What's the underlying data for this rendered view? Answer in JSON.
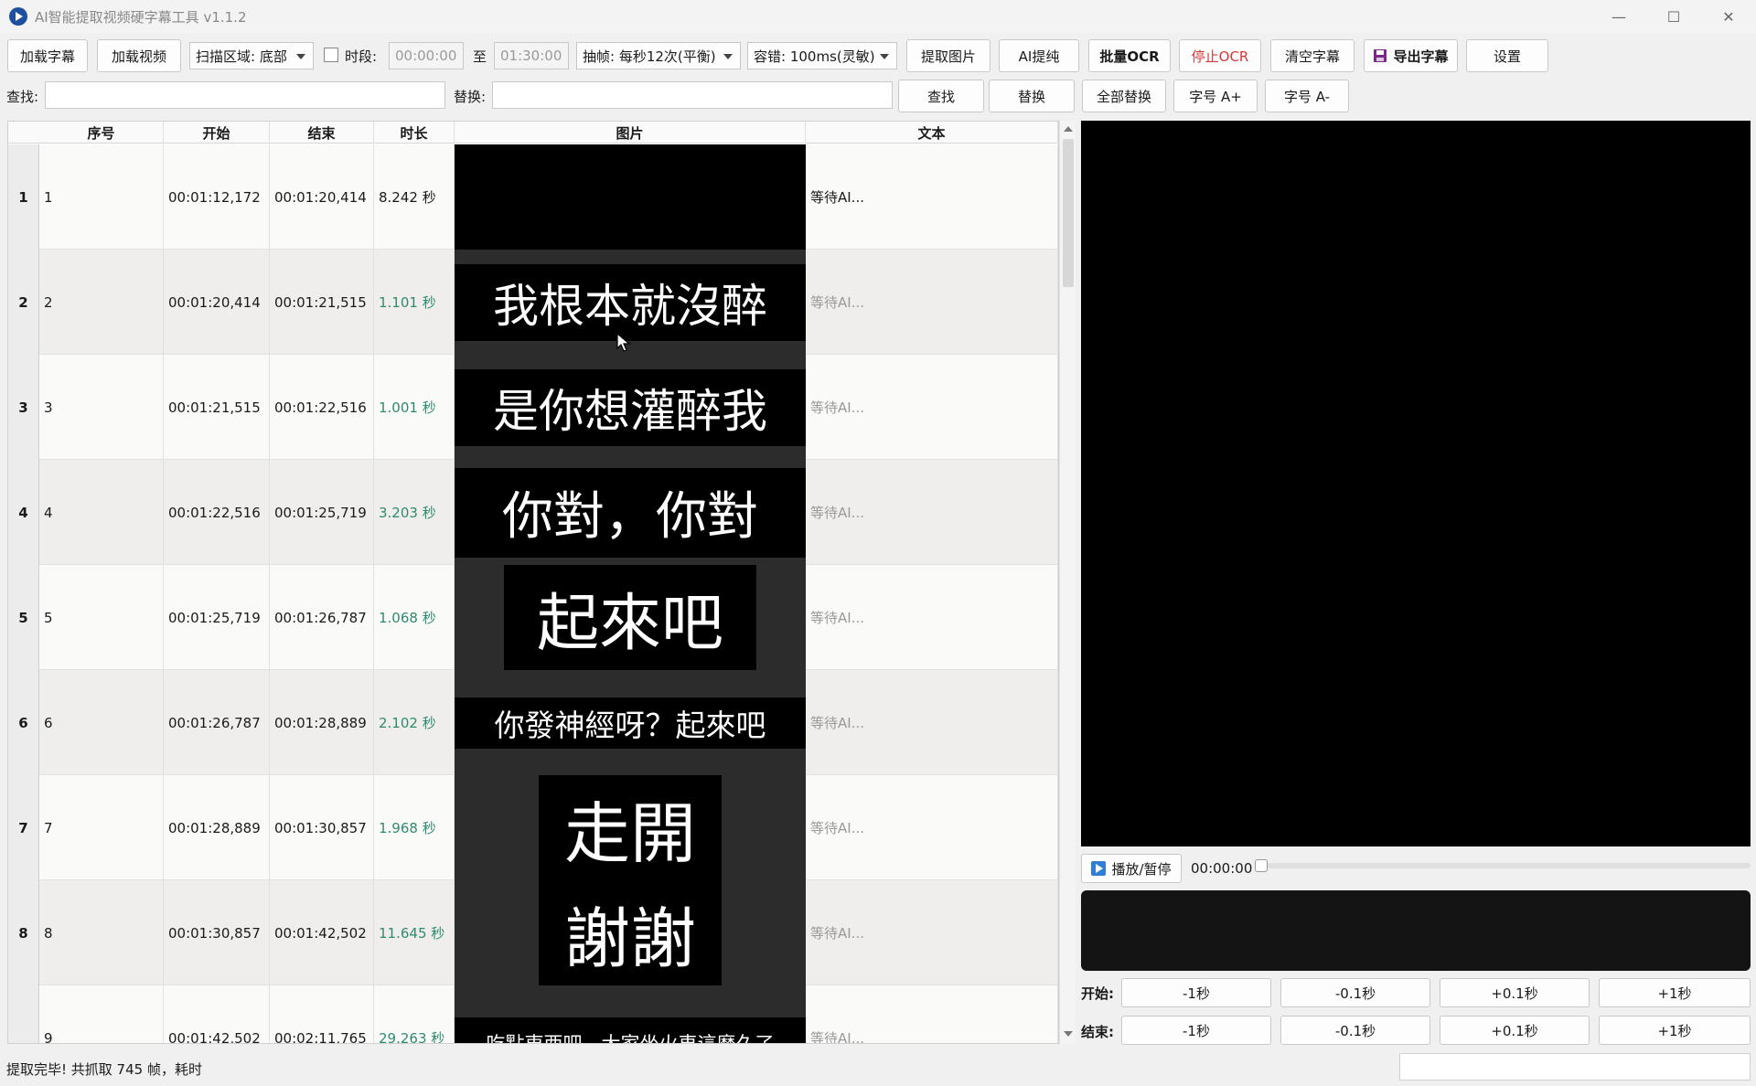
{
  "window": {
    "title": "AI智能提取视频硬字幕工具 v1.1.2",
    "minimize": "—",
    "maximize": "☐",
    "close": "✕"
  },
  "toolbar": {
    "load_subtitle": "加载字幕",
    "load_video": "加载视频",
    "scan_area": "扫描区域: 底部",
    "segment_label": "时段:",
    "segment_start": "00:00:00",
    "to_label": "至",
    "segment_end": "01:30:00",
    "frame_rate": "抽帧: 每秒12次(平衡)",
    "tolerance": "容错: 100ms(灵敏)",
    "extract_images": "提取图片",
    "ai_refine": "AI提纯",
    "batch_ocr": "批量OCR",
    "stop_ocr": "停止OCR",
    "clear_subtitles": "清空字幕",
    "export_subtitles": "导出字幕",
    "settings": "设置"
  },
  "search": {
    "find_label": "查找:",
    "replace_label": "替换:",
    "find_value": "",
    "replace_value": "",
    "find_button": "查找",
    "replace_button": "替换",
    "replace_all_button": "全部替换",
    "font_increase": "字号 A+",
    "font_decrease": "字号 A-"
  },
  "table": {
    "columns": [
      "序号",
      "开始",
      "结束",
      "时长",
      "图片",
      "文本"
    ],
    "rows": [
      {
        "row": "1",
        "index": "1",
        "start": "00:01:12,172",
        "end": "00:01:20,414",
        "duration": "8.242 秒",
        "image_text": "",
        "text": "等待AI..."
      },
      {
        "row": "2",
        "index": "2",
        "start": "00:01:20,414",
        "end": "00:01:21,515",
        "duration": "1.101 秒",
        "image_text": "我根本就沒醉",
        "text": "等待AI..."
      },
      {
        "row": "3",
        "index": "3",
        "start": "00:01:21,515",
        "end": "00:01:22,516",
        "duration": "1.001 秒",
        "image_text": "是你想灌醉我",
        "text": "等待AI..."
      },
      {
        "row": "4",
        "index": "4",
        "start": "00:01:22,516",
        "end": "00:01:25,719",
        "duration": "3.203 秒",
        "image_text": "你對，你對",
        "text": "等待AI..."
      },
      {
        "row": "5",
        "index": "5",
        "start": "00:01:25,719",
        "end": "00:01:26,787",
        "duration": "1.068 秒",
        "image_text": "起來吧",
        "text": "等待AI..."
      },
      {
        "row": "6",
        "index": "6",
        "start": "00:01:26,787",
        "end": "00:01:28,889",
        "duration": "2.102 秒",
        "image_text": "你發神經呀？起來吧",
        "text": "等待AI..."
      },
      {
        "row": "7",
        "index": "7",
        "start": "00:01:28,889",
        "end": "00:01:30,857",
        "duration": "1.968 秒",
        "image_text": "走開",
        "text": "等待AI..."
      },
      {
        "row": "8",
        "index": "8",
        "start": "00:01:30,857",
        "end": "00:01:42,502",
        "duration": "11.645 秒",
        "image_text": "謝謝",
        "text": "等待AI..."
      },
      {
        "row": "9",
        "index": "9",
        "start": "00:01:42,502",
        "end": "00:02:11,765",
        "duration": "29.263 秒",
        "image_text": "吃點東西吧，大家坐火車這麼久了",
        "text": "等待AI..."
      }
    ]
  },
  "player": {
    "play_pause": "播放/暂停",
    "time": "00:00:00",
    "progress": 0
  },
  "adjust": {
    "start_label": "开始:",
    "end_label": "结束:",
    "minus_1s": "-1秒",
    "minus_01s": "-0.1秒",
    "plus_01s": "+0.1秒",
    "plus_1s": "+1秒"
  },
  "status": {
    "message": "提取完毕! 共抓取 745 帧，耗时"
  },
  "colors": {
    "duration": "#2e8b6f",
    "stop_ocr": "#d23a3a",
    "accent": "#1f4fa0"
  }
}
